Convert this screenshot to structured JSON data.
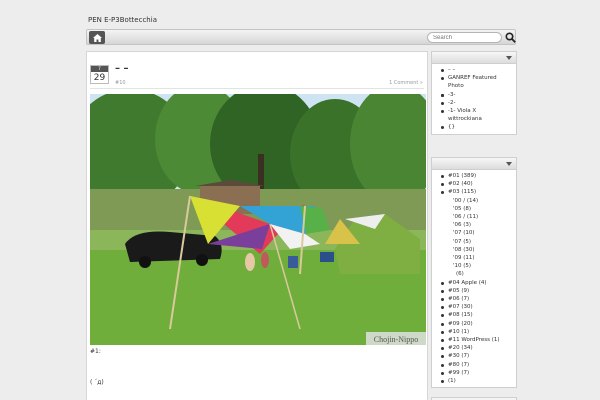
{
  "site": {
    "title": "PEN E-P3Bottecchia"
  },
  "nav": {
    "search_placeholder": "Search"
  },
  "post": {
    "month": "7",
    "day": "29",
    "title": "– –",
    "tag": "#10",
    "comments": "1 Comment »",
    "watermark": "Chojin-Nippo",
    "caption": "#1:",
    "face": "( ´д)"
  },
  "widget1": {
    "items": [
      "– –",
      "GANREF Featured Photo",
      "",
      "",
      "-3-",
      "-2-",
      "-1- Viola X wittrockiana",
      "{}"
    ]
  },
  "widget2": {
    "items": [
      {
        "t": "#01   (389)",
        "k": "top"
      },
      {
        "t": "#02      (40)",
        "k": "top"
      },
      {
        "t": "#03   (115)",
        "k": "top"
      },
      {
        "t": "'00 /     (14)",
        "k": "sub"
      },
      {
        "t": "'05   (8)",
        "k": "sub"
      },
      {
        "t": "'06 /       (11)",
        "k": "sub"
      },
      {
        "t": "'06   (3)",
        "k": "sub"
      },
      {
        "t": "'07   (10)",
        "k": "sub"
      },
      {
        "t": "'07   (5)",
        "k": "sub"
      },
      {
        "t": "'08   (30)",
        "k": "sub"
      },
      {
        "t": "'09   (11)",
        "k": "sub"
      },
      {
        "t": "'10   (5)",
        "k": "sub"
      },
      {
        "t": "(6)",
        "k": "cont"
      },
      {
        "t": "#04 Apple (4)",
        "k": "top"
      },
      {
        "t": "#05   (9)",
        "k": "top"
      },
      {
        "t": "#06        (7)",
        "k": "top"
      },
      {
        "t": "#07   (30)",
        "k": "top"
      },
      {
        "t": "#08        (15)",
        "k": "top"
      },
      {
        "t": "#09   (20)",
        "k": "top"
      },
      {
        "t": "#10           (1)",
        "k": "top"
      },
      {
        "t": "#11 WordPress (1)",
        "k": "top"
      },
      {
        "t": "#20      (34)",
        "k": "top"
      },
      {
        "t": "#30        (7)",
        "k": "top"
      },
      {
        "t": "#80   (7)",
        "k": "top"
      },
      {
        "t": "#99   (7)",
        "k": "top"
      },
      {
        "t": "(1)",
        "k": "top"
      }
    ]
  }
}
